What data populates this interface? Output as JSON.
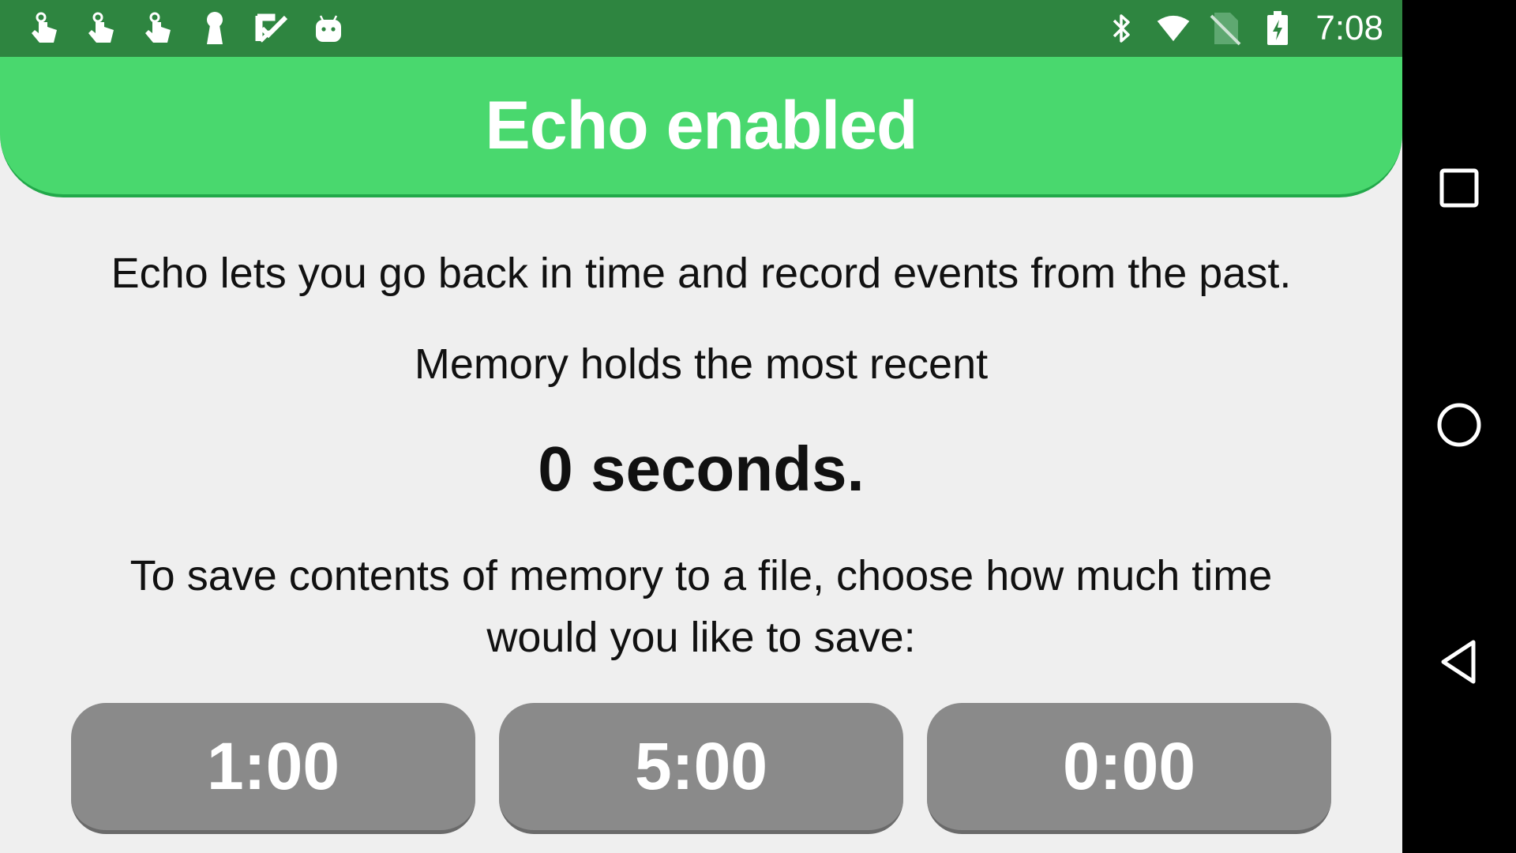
{
  "status_bar": {
    "notification_icons": [
      "touch-icon",
      "touch-icon",
      "touch-icon",
      "keyhole-icon",
      "check-icon",
      "android-icon"
    ],
    "system_icons": [
      "bluetooth-icon",
      "wifi-icon",
      "no-sim-icon",
      "battery-charging-icon"
    ],
    "time": "7:08",
    "bg_color": "#2e8540"
  },
  "header": {
    "title": "Echo enabled",
    "bg_color": "#49d86e"
  },
  "main": {
    "intro": "Echo lets you go back in time and record events from the past.",
    "memory_holds": "Memory holds the most recent",
    "seconds": "0 seconds.",
    "save_prompt": "To save contents of memory to a file, choose how much time would you like to save:"
  },
  "buttons": [
    {
      "label": "1:00"
    },
    {
      "label": "5:00"
    },
    {
      "label": "0:00"
    }
  ],
  "nav": {
    "buttons": [
      "recents-icon",
      "home-icon",
      "back-icon"
    ]
  }
}
